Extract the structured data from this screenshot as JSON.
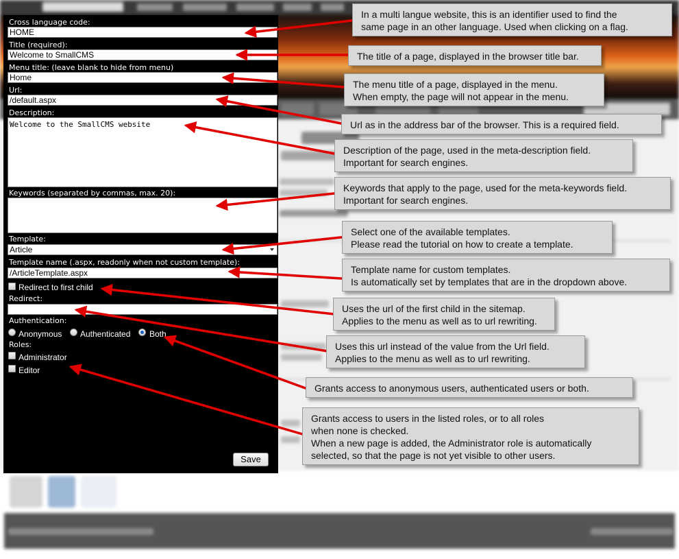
{
  "form": {
    "cross_language_label": "Cross language code:",
    "cross_language_value": "HOME",
    "title_label": "Title (required):",
    "title_value": "Welcome to SmallCMS",
    "menu_title_label": "Menu title: (leave blank to hide from menu)",
    "menu_title_value": "Home",
    "url_label": "Url:",
    "url_value": "/default.aspx",
    "description_label": "Description:",
    "description_value": "Welcome to the SmallCMS website",
    "keywords_label": "Keywords (separated by commas, max. 20):",
    "keywords_value": "",
    "template_label": "Template:",
    "template_value": "Article",
    "template_name_label": "Template name (.aspx, readonly when not custom template):",
    "template_name_value": "/ArticleTemplate.aspx",
    "redirect_first_child_label": "Redirect to first child",
    "redirect_first_child_checked": false,
    "redirect_label": "Redirect:",
    "redirect_value": "",
    "authentication_label": "Authentication:",
    "auth_options": [
      "Anonymous",
      "Authenticated",
      "Both"
    ],
    "auth_selected": "Both",
    "roles_label": "Roles:",
    "roles": [
      {
        "label": "Administrator",
        "checked": false
      },
      {
        "label": "Editor",
        "checked": false
      }
    ],
    "save_label": "Save"
  },
  "callouts": {
    "cross_language": [
      "In a multi langue website, this is an identifier used to find the",
      "same page in an other language. Used when clicking on a flag."
    ],
    "title": [
      "The title of a page, displayed in the browser title bar."
    ],
    "menu_title": [
      "The menu title of a page, displayed in the menu.",
      "When empty, the page will not appear in the menu."
    ],
    "url": [
      "Url as in the address bar of the browser. This is a required field."
    ],
    "description": [
      "Description of the page, used in the meta-description field.",
      "Important for search engines."
    ],
    "keywords": [
      "Keywords that apply to the page, used for the meta-keywords field.",
      "Important for search engines."
    ],
    "template": [
      "Select one of the available templates.",
      "Please read the tutorial on how to create a template."
    ],
    "template_name": [
      "Template name for custom templates.",
      "Is automatically set by templates that are in the dropdown above."
    ],
    "redirect_first_child": [
      "Uses the url of the first child in the sitemap.",
      "Applies to the menu as well as to url rewriting."
    ],
    "redirect": [
      "Uses this url instead of the value from the Url field.",
      "Applies to the menu as well as to url rewriting."
    ],
    "authentication": [
      "Grants access to anonymous users, authenticated users or both."
    ],
    "roles": [
      "Grants access to users in the listed roles, or to all roles",
      "when none is checked.",
      "When a new page is added, the Administrator role is automatically",
      "selected, so that the page is not yet visible to other users."
    ]
  },
  "colors": {
    "panel_bg": "#000000",
    "callout_bg": "#d9d9d9",
    "arrow": "#e00000"
  }
}
